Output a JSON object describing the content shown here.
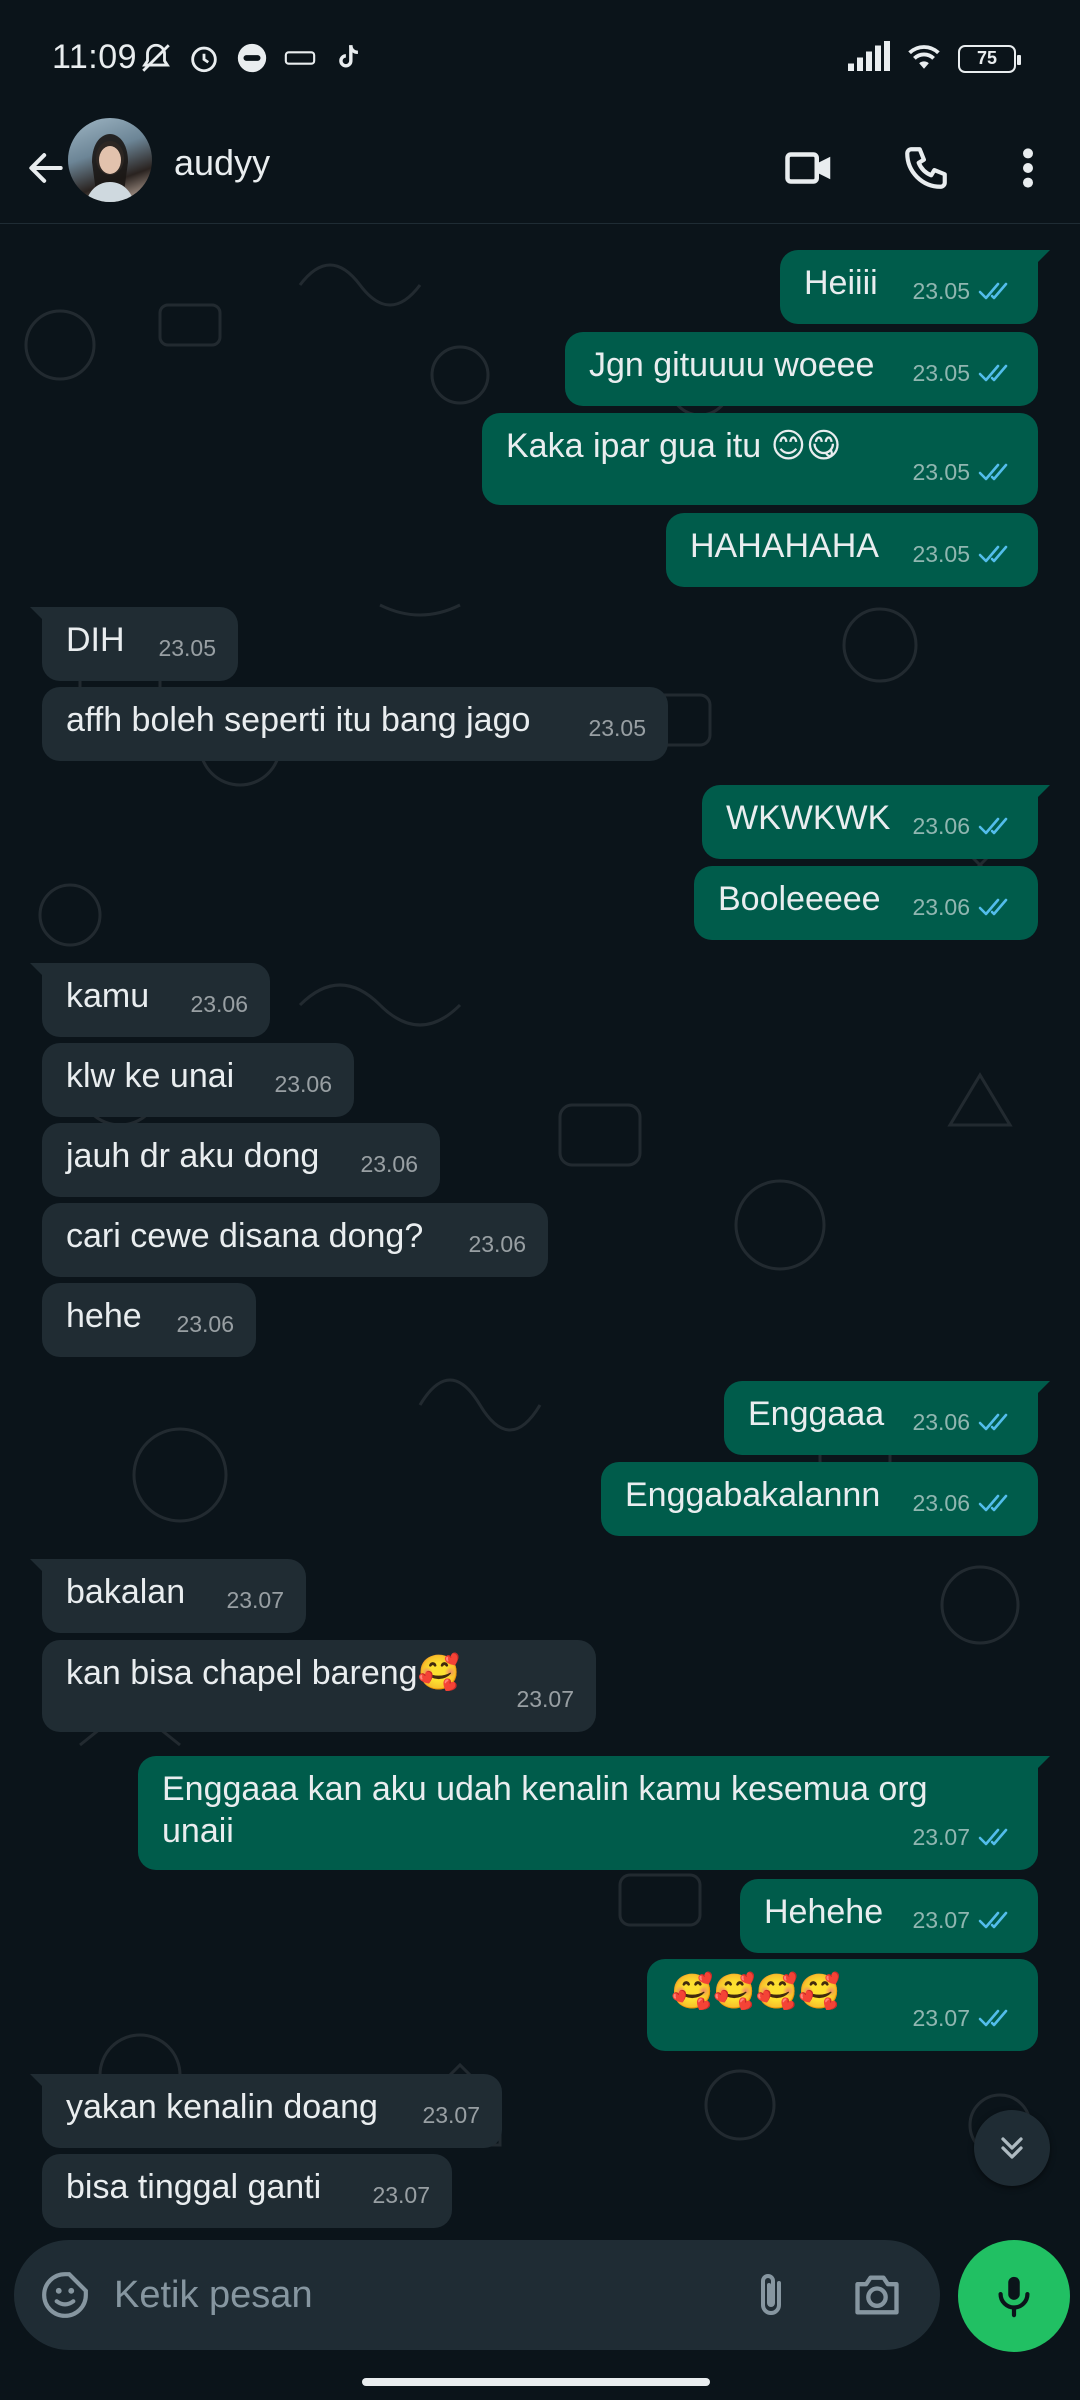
{
  "status_bar": {
    "time": "11:09",
    "battery": "75"
  },
  "header": {
    "contact_name": "audyy"
  },
  "messages": [
    {
      "dir": "out",
      "text": "Heiiii",
      "time": "23.05"
    },
    {
      "dir": "out",
      "text": "Jgn gituuuu woeee",
      "time": "23.05"
    },
    {
      "dir": "out",
      "text": "Kaka ipar gua itu 😊😋",
      "time": "23.05"
    },
    {
      "dir": "out",
      "text": "HAHAHAHA",
      "time": "23.05"
    },
    {
      "dir": "in",
      "text": "DIH",
      "time": "23.05"
    },
    {
      "dir": "in",
      "text": "affh boleh seperti itu bang jago",
      "time": "23.05"
    },
    {
      "dir": "out",
      "text": "WKWKWK",
      "time": "23.06"
    },
    {
      "dir": "out",
      "text": "Booleeeee",
      "time": "23.06"
    },
    {
      "dir": "in",
      "text": "kamu",
      "time": "23.06"
    },
    {
      "dir": "in",
      "text": "klw ke unai",
      "time": "23.06"
    },
    {
      "dir": "in",
      "text": "jauh dr aku dong",
      "time": "23.06"
    },
    {
      "dir": "in",
      "text": "cari cewe disana dong?",
      "time": "23.06"
    },
    {
      "dir": "in",
      "text": "hehe",
      "time": "23.06"
    },
    {
      "dir": "out",
      "text": "Enggaaa",
      "time": "23.06"
    },
    {
      "dir": "out",
      "text": "Enggabakalannn",
      "time": "23.06"
    },
    {
      "dir": "in",
      "text": "bakalan",
      "time": "23.07"
    },
    {
      "dir": "in",
      "text": "kan bisa chapel bareng🥰",
      "time": "23.07"
    },
    {
      "dir": "out",
      "text": "Enggaaa kan aku udah kenalin kamu kesemua org\nunaii",
      "time": "23.07"
    },
    {
      "dir": "out",
      "text": "Hehehe",
      "time": "23.07"
    },
    {
      "dir": "out",
      "text": "🥰🥰🥰🥰",
      "time": "23.07"
    },
    {
      "dir": "in",
      "text": "yakan kenalin doang",
      "time": "23.07"
    },
    {
      "dir": "in",
      "text": "bisa tinggal ganti",
      "time": "23.07"
    }
  ],
  "input": {
    "placeholder": "Ketik pesan"
  },
  "colors": {
    "outgoing_bubble": "#005c4b",
    "incoming_bubble": "#202c33",
    "read_ticks": "#53bdeb",
    "mic_button": "#21c063"
  }
}
